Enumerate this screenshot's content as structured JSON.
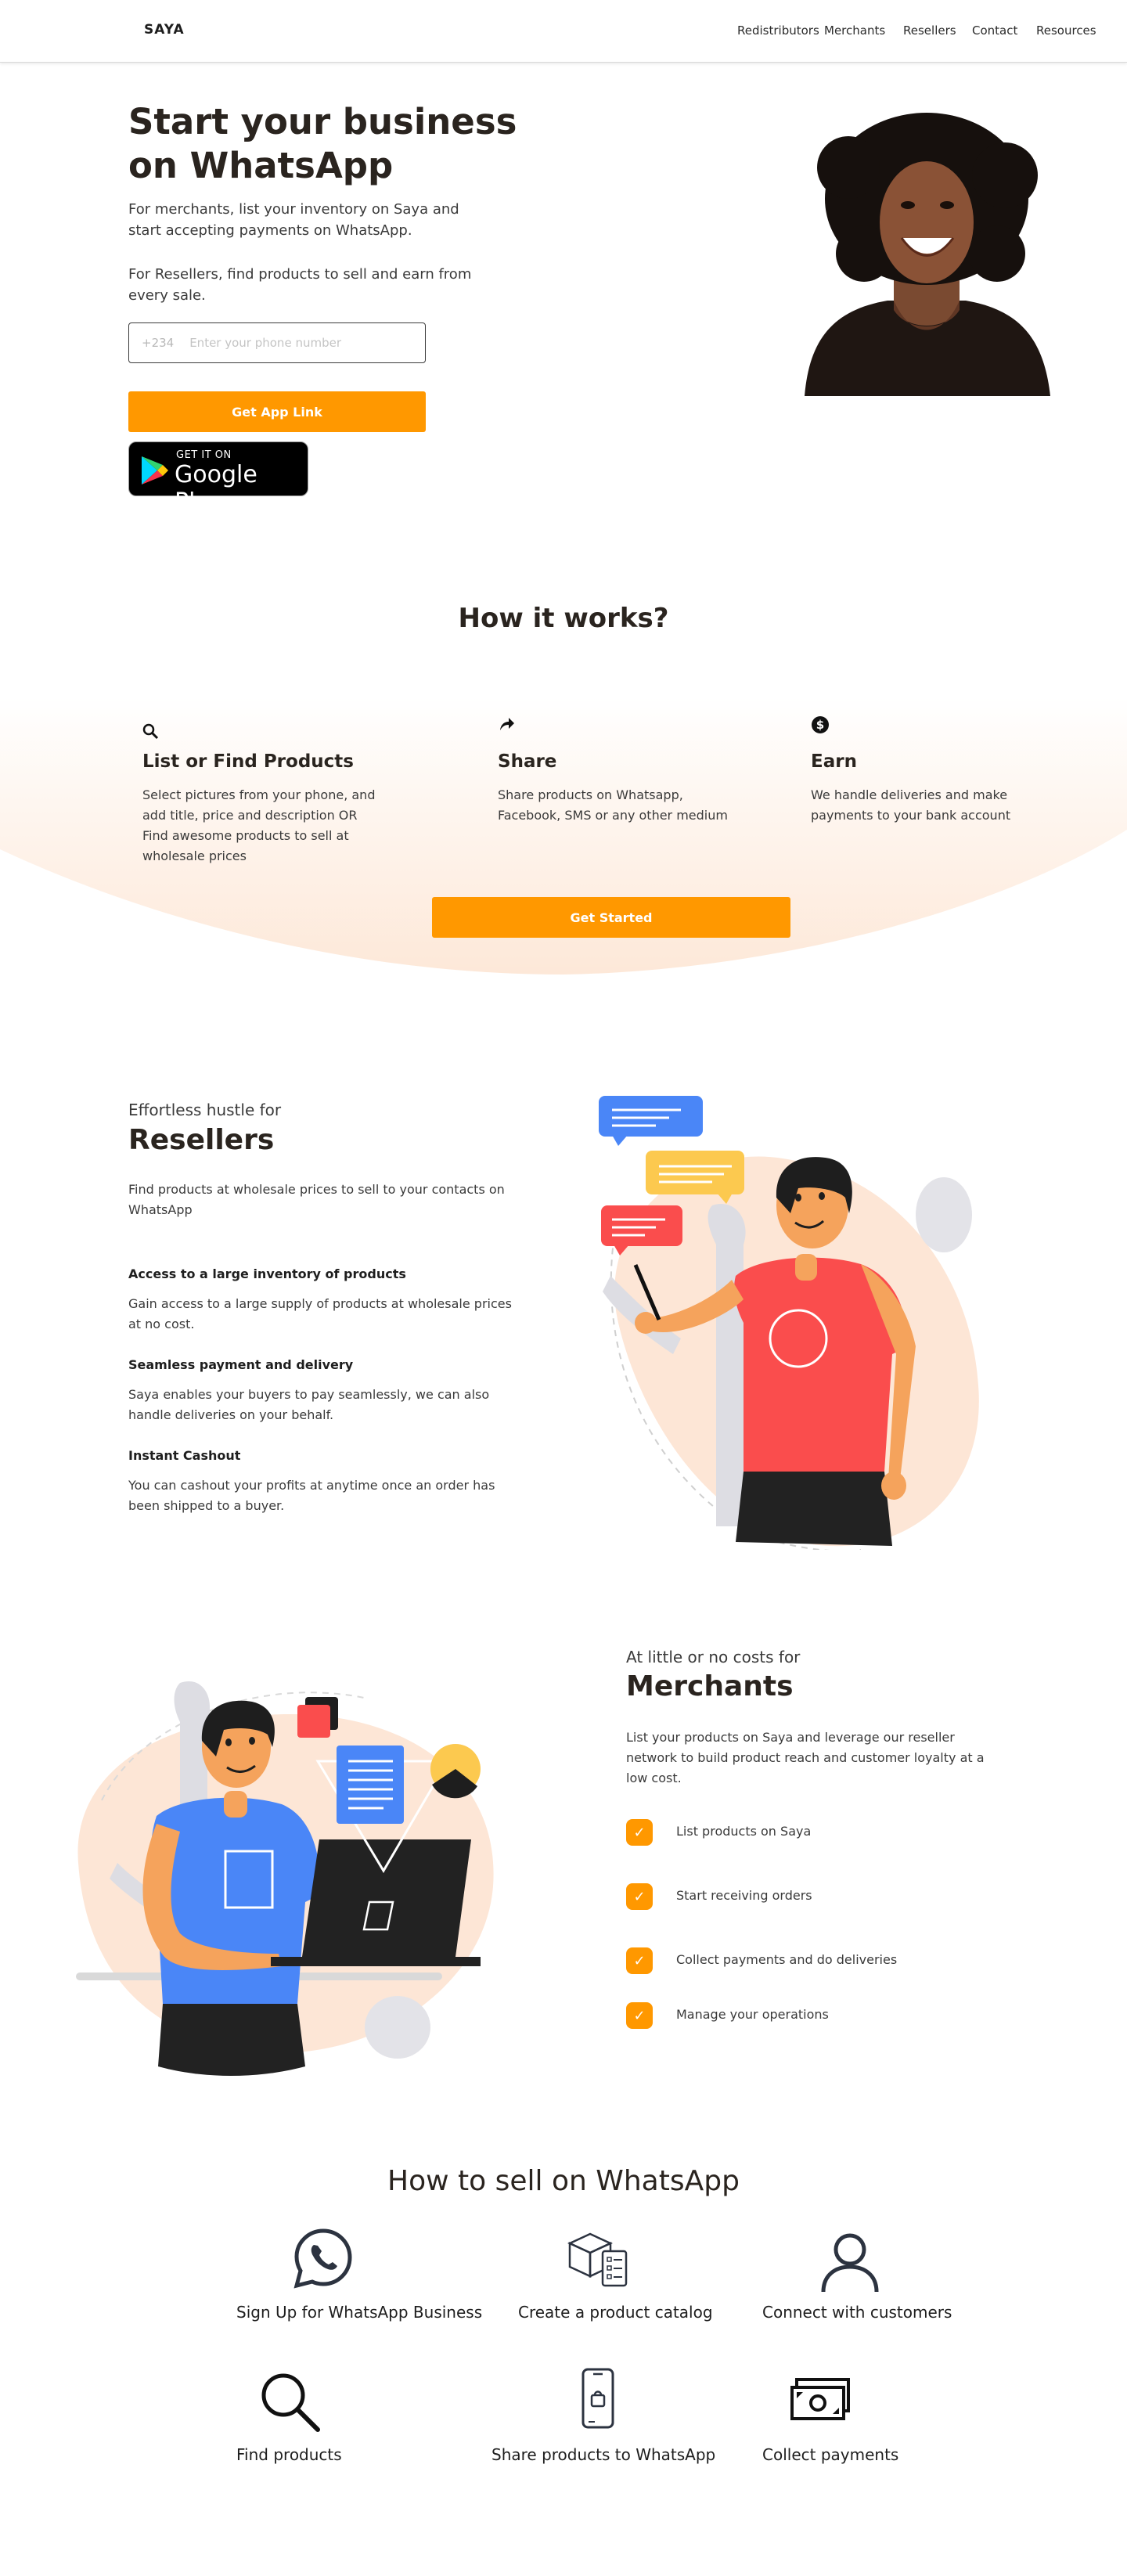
{
  "header": {
    "logo": "SAYA",
    "nav": [
      "Redistributors",
      "Merchants",
      "Resellers",
      "Contact",
      "Resources"
    ]
  },
  "hero": {
    "title": "Start your business on WhatsApp",
    "merchants_text": "For merchants, list your inventory on Saya and start accepting payments on WhatsApp.",
    "resellers_text": "For Resellers, find products to sell and earn from every sale.",
    "phone_prefix": "+234",
    "phone_placeholder": "Enter your phone number",
    "cta_label": "Get App Link",
    "gplay_small": "GET IT ON",
    "gplay_big": "Google Play"
  },
  "how_it_works": {
    "title": "How it works?",
    "steps": [
      {
        "icon": "search-icon",
        "title": "List or Find Products",
        "text": "Select pictures from your phone, and add title, price and description   OR Find awesome products to sell at wholesale prices"
      },
      {
        "icon": "share-arrow-icon",
        "title": "Share",
        "text": "Share products on Whatsapp, Facebook, SMS or any other medium"
      },
      {
        "icon": "dollar-coin-icon",
        "title": "Earn",
        "text": "We handle deliveries and make payments to your bank account"
      }
    ],
    "cta_label": "Get Started"
  },
  "resellers": {
    "eyebrow": "Effortless hustle for",
    "title": "Resellers",
    "intro": "Find products at wholesale prices to sell to your contacts on WhatsApp",
    "features": [
      {
        "title": "Access to a large inventory of  products",
        "text": "Gain access to a large supply of products at wholesale prices at no cost."
      },
      {
        "title": "Seamless payment and delivery",
        "text": "Saya enables your buyers to pay seamlessly, we can also handle deliveries on your behalf."
      },
      {
        "title": "Instant Cashout",
        "text": "You can cashout your profits at anytime once an order has been shipped to a buyer."
      }
    ]
  },
  "merchants": {
    "eyebrow": "At little or no costs for",
    "title": "Merchants",
    "intro": "List your products on Saya and leverage our reseller network to build product reach and customer loyalty at a low cost.",
    "checklist": [
      "List products on Saya",
      "Start receiving orders",
      "Collect payments and do deliveries",
      "Manage your operations"
    ]
  },
  "how_to_sell": {
    "title": "How to sell on WhatsApp",
    "items": [
      {
        "icon": "whatsapp-icon",
        "label": "Sign Up for WhatsApp Business"
      },
      {
        "icon": "catalog-box-icon",
        "label": "Create a product catalog"
      },
      {
        "icon": "user-icon",
        "label": "Connect with customers"
      },
      {
        "icon": "magnifier-icon",
        "label": "Find products"
      },
      {
        "icon": "smartphone-bag-icon",
        "label": "Share products to WhatsApp"
      },
      {
        "icon": "cash-icon",
        "label": "Collect  payments"
      }
    ]
  },
  "colors": {
    "accent": "#ff9800",
    "heading": "#2a241f",
    "peach": "#fde6d6",
    "shirt_red": "#fa4d4d",
    "shirt_blue": "#4a86f7",
    "bubble_yellow": "#fcc94f"
  }
}
